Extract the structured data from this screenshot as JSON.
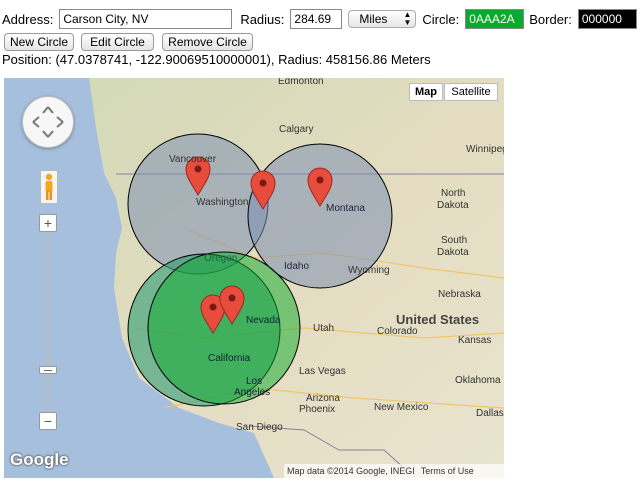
{
  "form": {
    "address_label": "Address:",
    "address_value": "Carson City, NV",
    "radius_label": "Radius:",
    "radius_value": "284.69",
    "unit_value": "Miles",
    "circle_label": "Circle:",
    "circle_color_value": "0AAA2A",
    "border_label": "Border:",
    "border_color_value": "000000"
  },
  "colors": {
    "circle": "#0AAA2A",
    "border": "#000000"
  },
  "buttons": {
    "new_circle": "New Circle",
    "edit_circle": "Edit Circle",
    "remove_circle": "Remove Circle"
  },
  "status": {
    "position_text": "Position: (47.0378741, -122.90069510000001), Radius: 458156.86 Meters"
  },
  "map": {
    "type_map": "Map",
    "type_satellite": "Satellite",
    "zoom_in": "+",
    "zoom_out": "−",
    "logo": "Google",
    "attribution": "Map data ©2014 Google, INEGI",
    "terms": "Terms of Use",
    "places": {
      "edmonton": "Edmonton",
      "calgary": "Calgary",
      "winnipeg": "Winnipeg",
      "vancouver": "Vancouver",
      "washington": "Washington",
      "montana": "Montana",
      "north_dakota": "North\nDakota",
      "south_dakota": "South\nDakota",
      "oregon": "Oregon",
      "idaho": "Idaho",
      "wyoming": "Wyoming",
      "nebraska": "Nebraska",
      "united_states": "United States",
      "nevada": "Nevada",
      "utah": "Utah",
      "california": "California",
      "colorado": "Colorado",
      "kansas": "Kansas",
      "las_vegas": "Las Vegas",
      "los_angeles": "Los\nAngeles",
      "arizona": "Arizona",
      "phoenix": "Phoenix",
      "new_mexico": "New Mexico",
      "oklahoma": "Oklahoma",
      "san_diego": "San Diego",
      "dallas": "Dallas"
    }
  }
}
